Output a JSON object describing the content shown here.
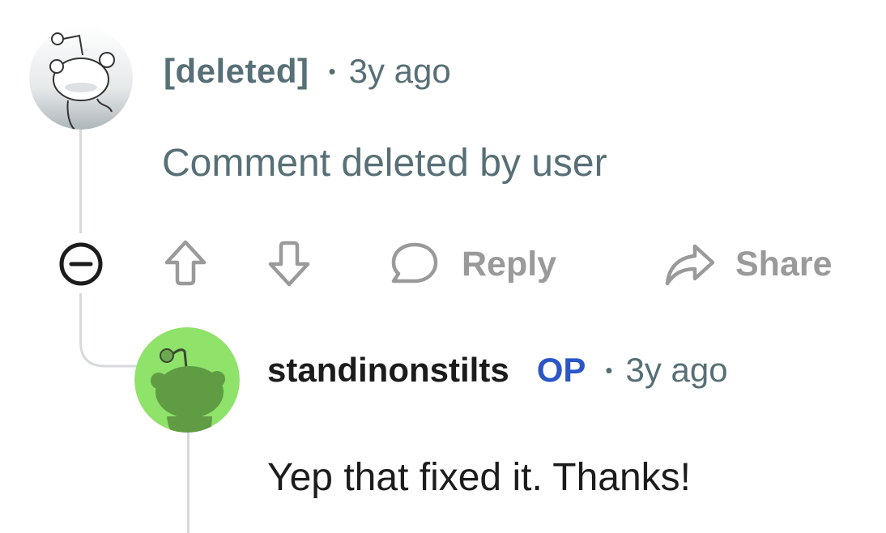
{
  "comment": {
    "author": "[deleted]",
    "separator": "•",
    "timestamp": "3y ago",
    "body": "Comment deleted by user",
    "actions": {
      "reply_label": "Reply",
      "share_label": "Share"
    }
  },
  "reply": {
    "author": "standinonstilts",
    "op_badge": "OP",
    "separator": "•",
    "timestamp": "3y ago",
    "body": "Yep that fixed it. Thanks!"
  },
  "icons": {
    "collapse": "collapse-minus-icon",
    "upvote": "upvote-arrow-icon",
    "downvote": "downvote-arrow-icon",
    "reply": "speech-bubble-icon",
    "share": "share-arrow-icon"
  },
  "colors": {
    "meta_gray": "#576f76",
    "action_gray": "#9a9a9a",
    "op_blue": "#2a56c6",
    "avatar_green": "#8fe26a",
    "snoo_green": "#5f9c44",
    "thread_line": "#d7dadc"
  }
}
